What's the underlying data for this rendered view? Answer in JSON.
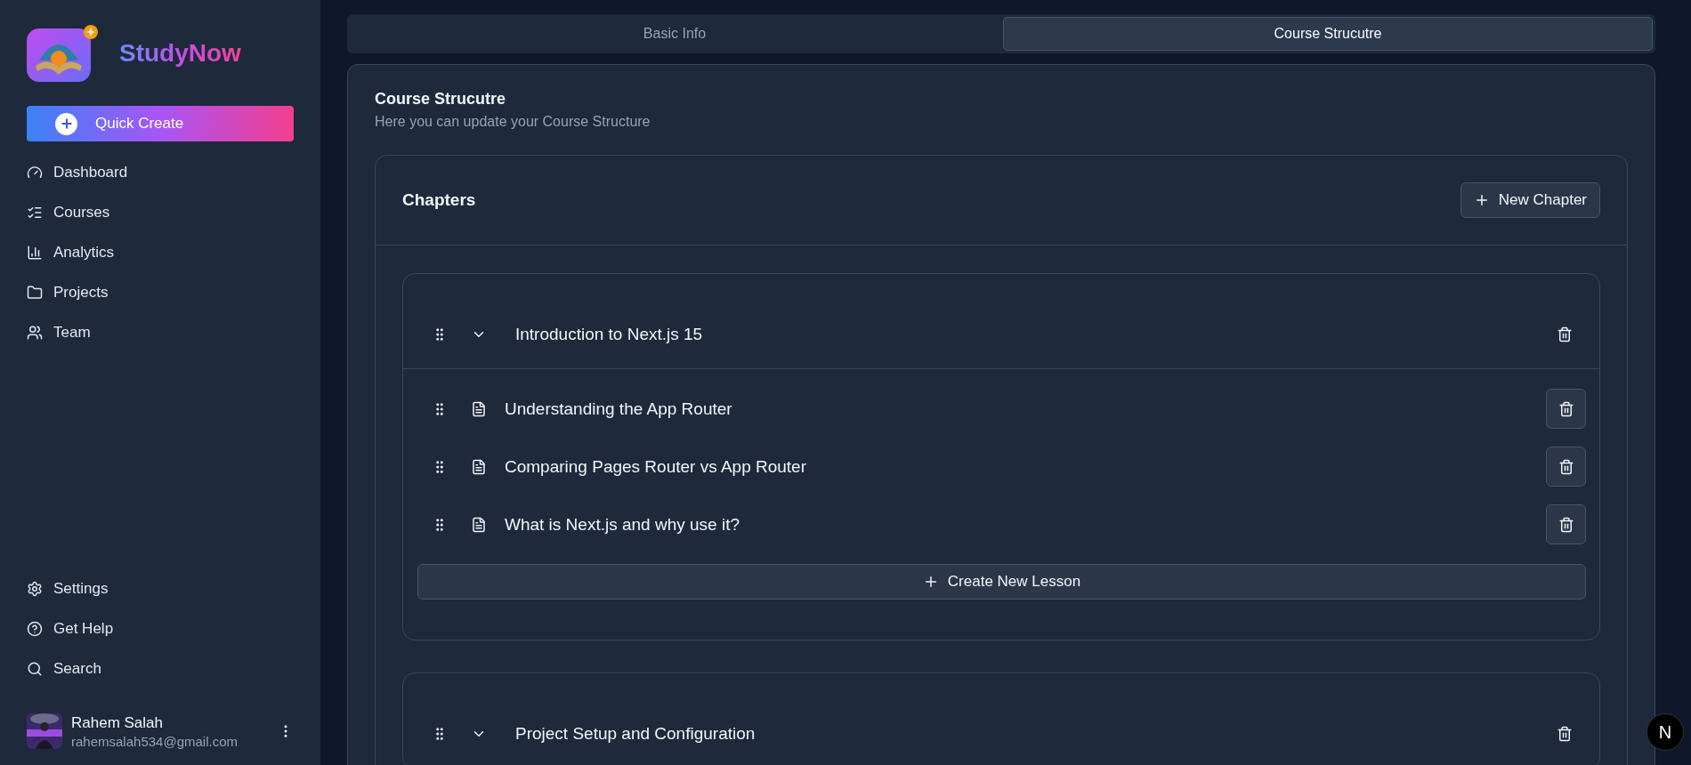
{
  "sidebar": {
    "brand": "StudyNow",
    "quick_create": "Quick Create",
    "nav": [
      {
        "label": "Dashboard"
      },
      {
        "label": "Courses"
      },
      {
        "label": "Analytics"
      },
      {
        "label": "Projects"
      },
      {
        "label": "Team"
      }
    ],
    "secondary": [
      {
        "label": "Settings"
      },
      {
        "label": "Get Help"
      },
      {
        "label": "Search"
      }
    ],
    "user": {
      "name": "Rahem Salah",
      "email": "rahemsalah534@gmail.com"
    }
  },
  "tabs": [
    {
      "label": "Basic Info",
      "selected": false
    },
    {
      "label": "Course Strucutre",
      "selected": true
    }
  ],
  "card": {
    "title": "Course Strucutre",
    "subtitle": "Here you can update your Course Structure"
  },
  "chapters_panel": {
    "title": "Chapters",
    "new_button": "New Chapter",
    "create_lesson": "Create New Lesson",
    "chapters": [
      {
        "title": "Introduction to Next.js 15",
        "expanded": true,
        "lessons": [
          {
            "title": "Understanding the App Router"
          },
          {
            "title": "Comparing Pages Router vs App Router"
          },
          {
            "title": "What is Next.js and why use it?"
          }
        ]
      },
      {
        "title": "Project Setup and Configuration",
        "expanded": true
      }
    ]
  },
  "dev_badge": "N"
}
